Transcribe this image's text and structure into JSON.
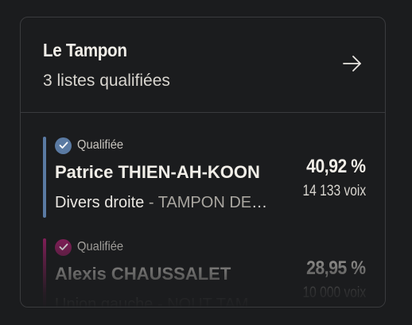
{
  "card": {
    "title": "Le Tampon",
    "subtitle": "3 listes qualifiées",
    "arrow_icon": "arrow-right-icon"
  },
  "colors": {
    "background": "#1b1c1e",
    "border": "#3a3b3e",
    "text": "#f1eee8",
    "muted": "#a9a6a0"
  },
  "lists": [
    {
      "status": "Qualifiée",
      "status_icon": "check-circle-icon",
      "color": "#5a7aa3",
      "candidate": "Patrice THIEN-AH-KOON",
      "party": "Divers droite",
      "separator": " - ",
      "list_name": "TAMPON DEMAIN",
      "percent": "40,92 %",
      "votes": "14 133 voix"
    },
    {
      "status": "Qualifiée",
      "status_icon": "check-circle-icon",
      "color": "#8c1f5e",
      "candidate": "Alexis CHAUSSALET",
      "party": "Union gauche",
      "separator": " - ",
      "list_name": "NOUT TAMPON",
      "percent": "28,95 %",
      "votes": "10 000 voix"
    }
  ]
}
